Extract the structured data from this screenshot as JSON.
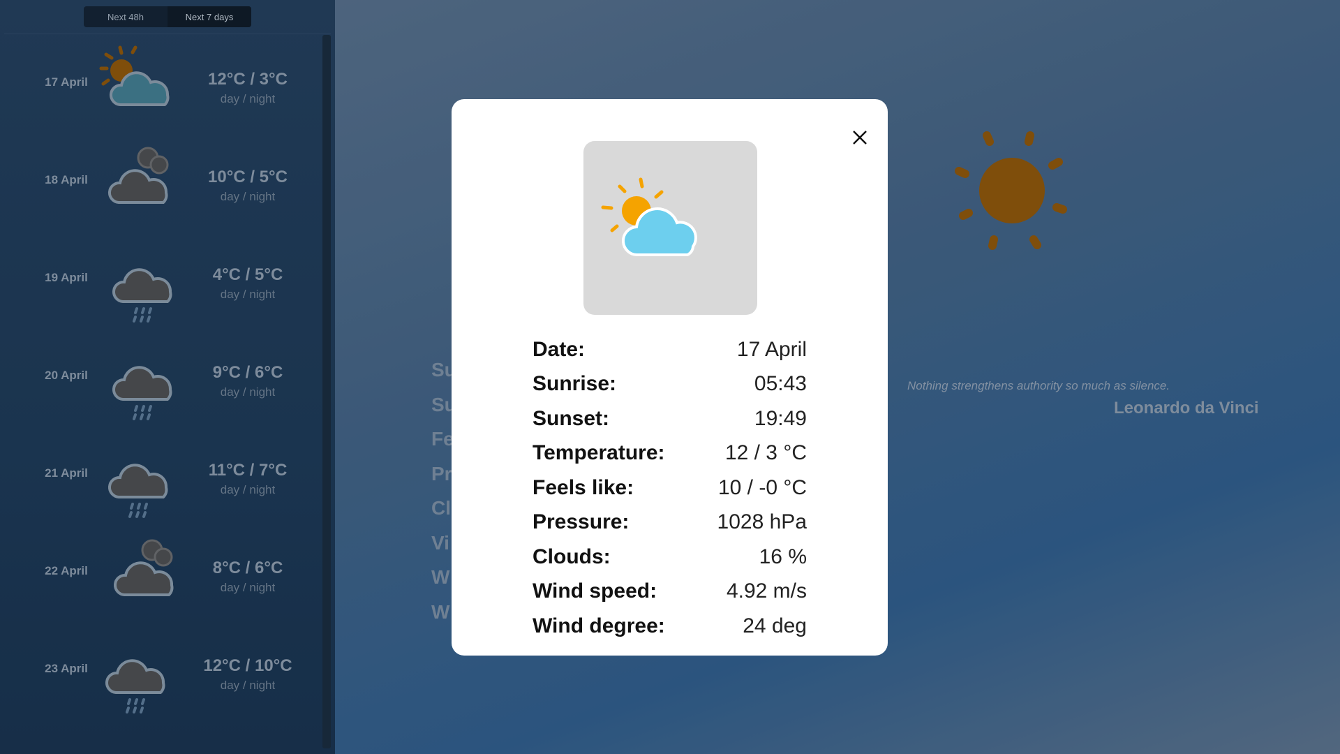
{
  "toggle": {
    "options": [
      "Next 48h",
      "Next 7 days"
    ],
    "active": 1
  },
  "forecast": [
    {
      "date": "17 April",
      "temp": "12°C / 3°C",
      "sub": "day / night",
      "icon": "partly-cloudy-icon"
    },
    {
      "date": "18 April",
      "temp": "10°C / 5°C",
      "sub": "day / night",
      "icon": "cloudy-icon"
    },
    {
      "date": "19 April",
      "temp": "4°C / 5°C",
      "sub": "day / night",
      "icon": "rain-icon"
    },
    {
      "date": "20 April",
      "temp": "9°C / 6°C",
      "sub": "day / night",
      "icon": "rain-icon"
    },
    {
      "date": "21 April",
      "temp": "11°C / 7°C",
      "sub": "day / night",
      "icon": "rain-icon"
    },
    {
      "date": "22 April",
      "temp": "8°C / 6°C",
      "sub": "day / night",
      "icon": "cloudy-icon"
    },
    {
      "date": "23 April",
      "temp": "12°C / 10°C",
      "sub": "day / night",
      "icon": "rain-icon"
    }
  ],
  "background": {
    "quote": "Nothing strengthens authority so much as silence.",
    "author": "Leonardo da Vinci",
    "labels": [
      "Su",
      "Su",
      "Fe",
      "Pr",
      "Cl",
      "Vi",
      "W",
      "W"
    ]
  },
  "modal": {
    "rows": [
      {
        "label": "Date:",
        "value": "17 April"
      },
      {
        "label": "Sunrise:",
        "value": "05:43"
      },
      {
        "label": "Sunset:",
        "value": "19:49"
      },
      {
        "label": "Temperature:",
        "value": "12 / 3 °C"
      },
      {
        "label": "Feels like:",
        "value": "10 / -0 °C"
      },
      {
        "label": "Pressure:",
        "value": "1028 hPa"
      },
      {
        "label": "Clouds:",
        "value": "16 %"
      },
      {
        "label": "Wind speed:",
        "value": "4.92 m/s"
      },
      {
        "label": "Wind degree:",
        "value": "24 deg"
      }
    ]
  },
  "colors": {
    "sun": "#f5a300",
    "cloud": "#6dcfee",
    "dim_sun": "#8f5300",
    "dim_cloud": "#4a4a4a"
  }
}
